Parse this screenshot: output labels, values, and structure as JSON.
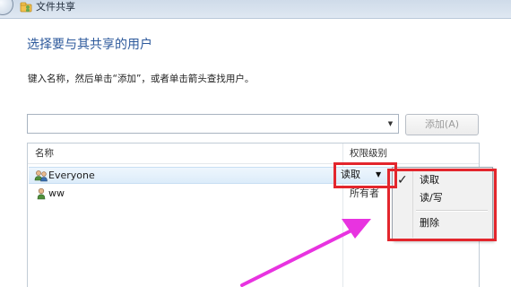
{
  "window": {
    "title": "文件共享"
  },
  "page": {
    "heading": "选择要与其共享的用户",
    "instruction": "键入名称，然后单击“添加”，或者单击箭头查找用户。"
  },
  "user_picker": {
    "value": "",
    "add_button_label": "添加(A)",
    "add_button_enabled": false
  },
  "list": {
    "columns": {
      "name": "名称",
      "permission": "权限级别"
    },
    "rows": [
      {
        "name": "Everyone",
        "permission": "读取",
        "icon": "user-group-icon",
        "selected": true
      },
      {
        "name": "ww",
        "permission": "所有者",
        "icon": "user-icon",
        "selected": false
      }
    ]
  },
  "permission_menu": {
    "items": [
      {
        "label": "读取",
        "checked": true
      },
      {
        "label": "读/写",
        "checked": false
      },
      {
        "label": "删除",
        "checked": false
      }
    ]
  },
  "annotations": {
    "highlight_color": "#e3262d",
    "arrow_color": "#e833e0"
  },
  "colors": {
    "heading": "#2e5a9c",
    "selection": "#dcecfa"
  }
}
